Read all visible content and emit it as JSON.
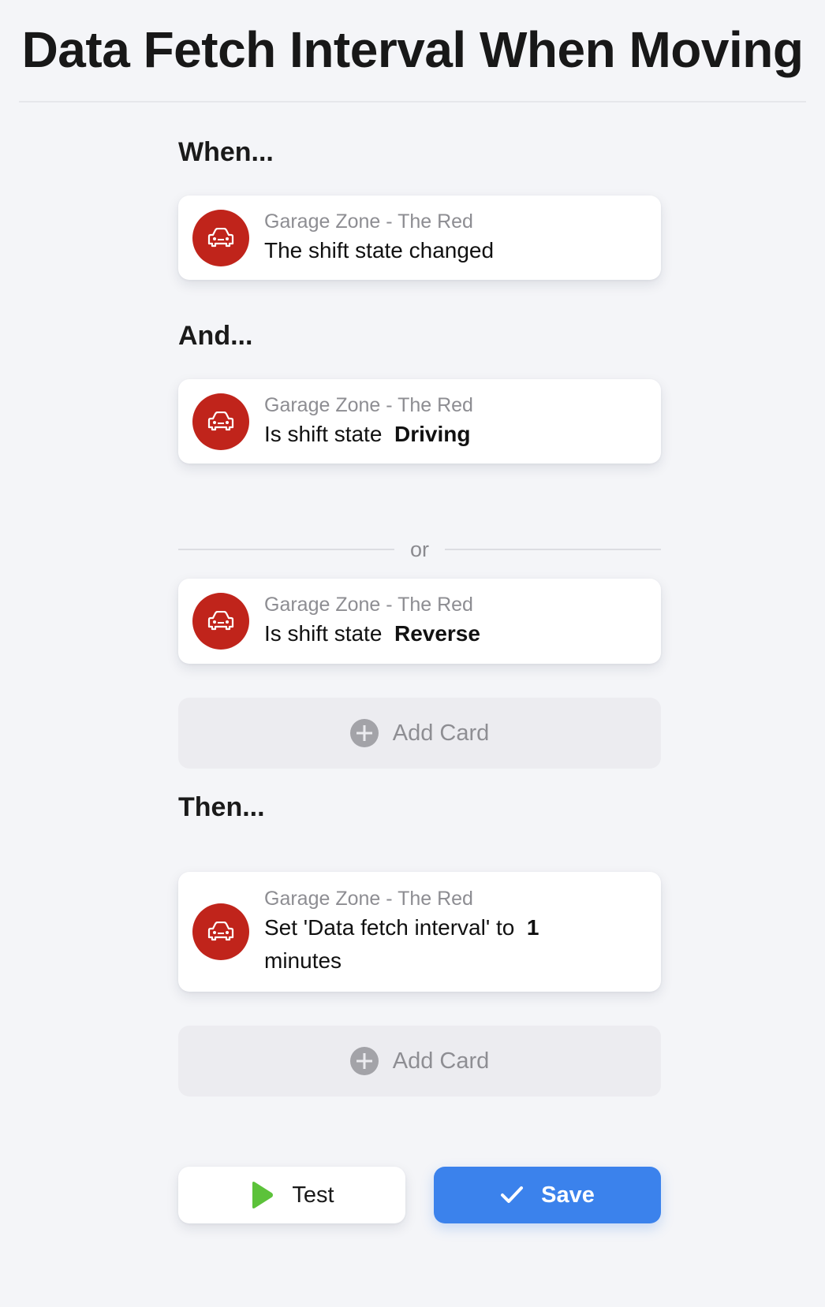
{
  "page": {
    "title": "Data Fetch Interval When Moving"
  },
  "sections": {
    "when": "When...",
    "and": "And...",
    "then": "Then..."
  },
  "when_card": {
    "device": "Garage Zone - The Red",
    "text": "The shift state changed",
    "icon": "car-icon"
  },
  "and_cards": [
    {
      "device": "Garage Zone - The Red",
      "text": "Is shift state",
      "value": "Driving",
      "icon": "car-icon"
    },
    {
      "device": "Garage Zone - The Red",
      "text": "Is shift state",
      "value": "Reverse",
      "icon": "car-icon"
    }
  ],
  "or_label": "or",
  "then_card": {
    "device": "Garage Zone - The Red",
    "text": "Set 'Data fetch interval' to",
    "value": "1",
    "suffix": "minutes",
    "icon": "car-icon"
  },
  "add_card_label": "Add Card",
  "buttons": {
    "test": "Test",
    "save": "Save"
  },
  "colors": {
    "icon_bg": "#c0241b",
    "save_bg": "#3b82ec",
    "play_icon": "#5cc23a"
  }
}
